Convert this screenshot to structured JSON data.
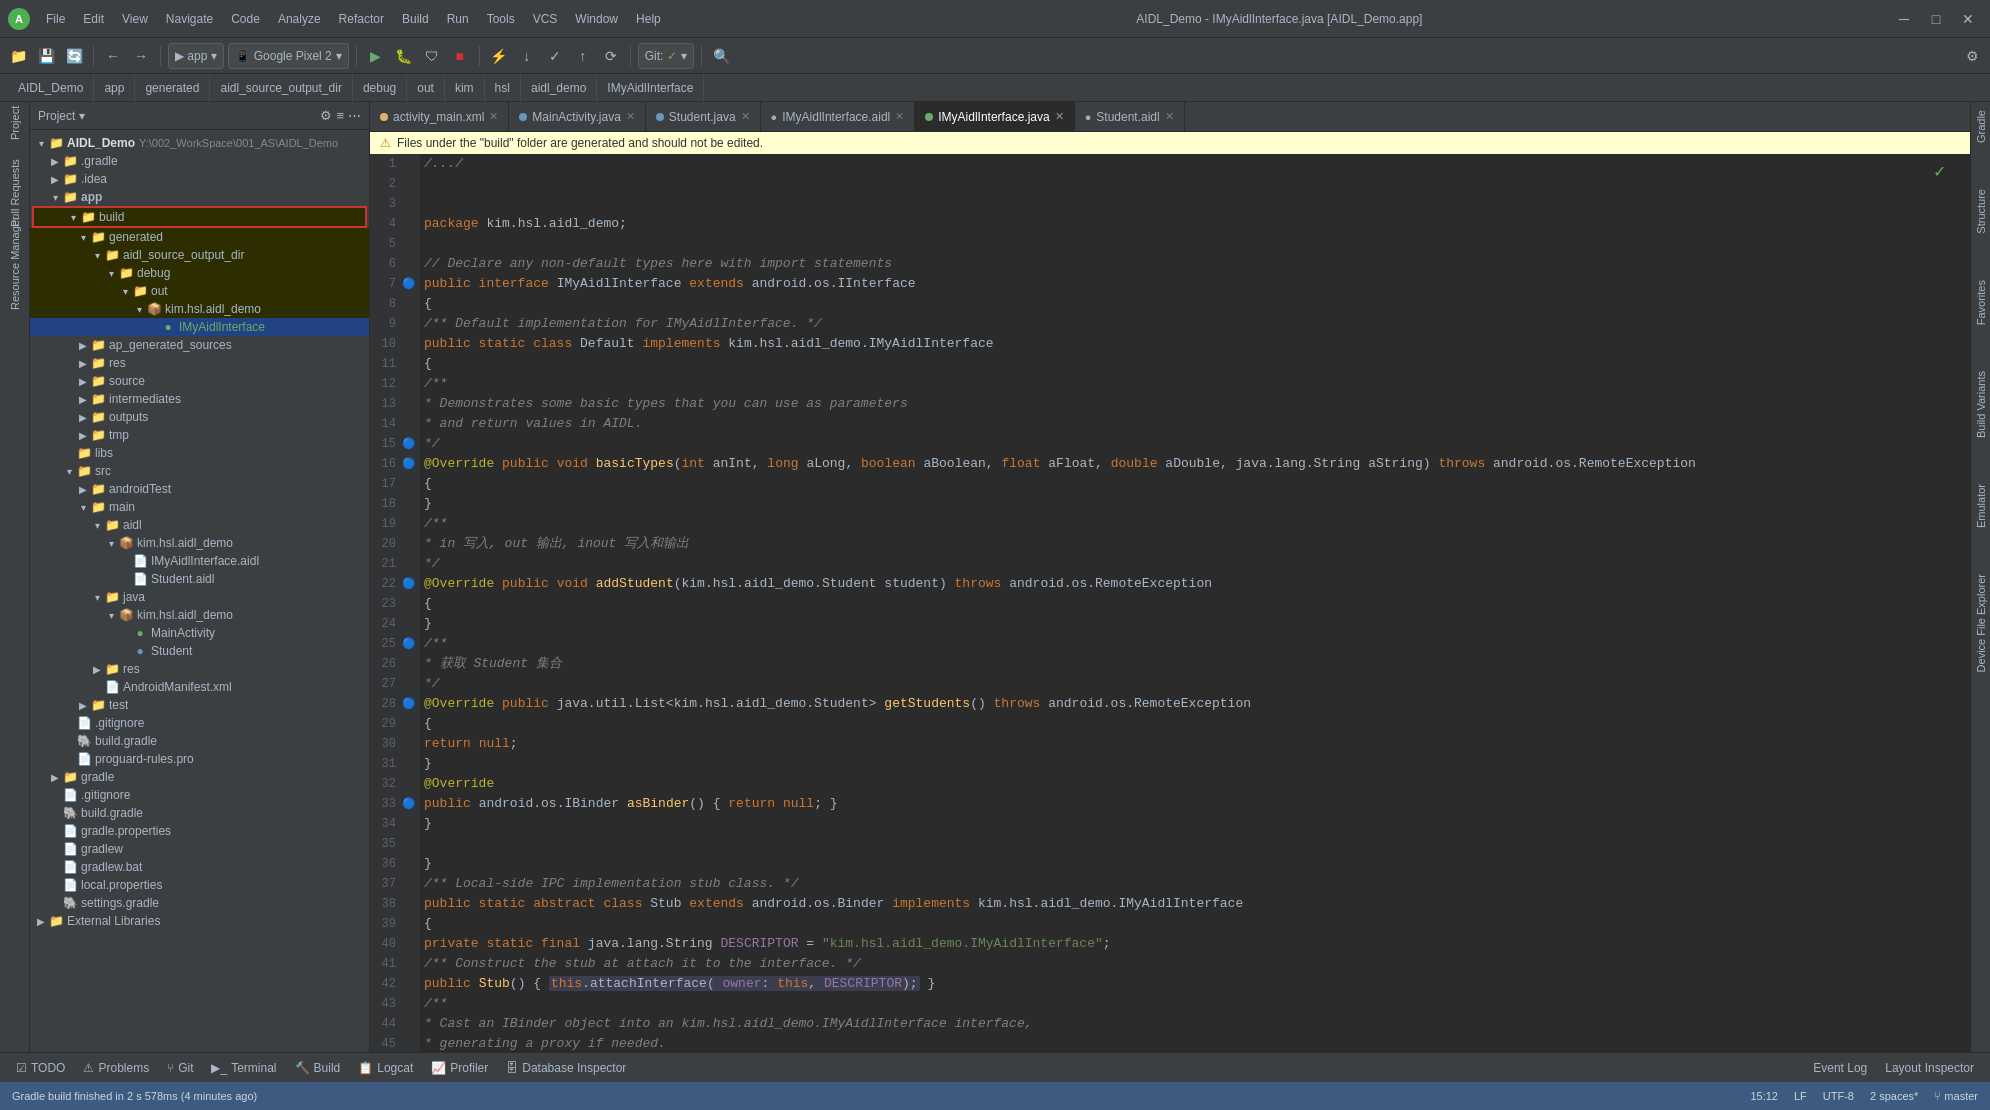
{
  "titlebar": {
    "project": "AIDL_Demo",
    "file": "IMyAidlInterface.java [AIDL_Demo.app]",
    "menus": [
      "File",
      "Edit",
      "View",
      "Navigate",
      "Code",
      "Analyze",
      "Refactor",
      "Build",
      "Run",
      "Tools",
      "VCS",
      "Window",
      "Help"
    ]
  },
  "breadcrumbs": [
    "AIDL_Demo",
    "app",
    "generated",
    "aidl_source_output_dir",
    "debug",
    "out",
    "kim",
    "hsl",
    "aidl_demo",
    "IMyAidlInterface"
  ],
  "editor_tabs": [
    {
      "label": "activity_main.xml",
      "type": "xml",
      "active": false
    },
    {
      "label": "MainActivity.java",
      "type": "java",
      "active": false
    },
    {
      "label": "Student.java",
      "type": "java",
      "active": false
    },
    {
      "label": "IMyAidlInterface.aidl",
      "type": "aidl",
      "active": false
    },
    {
      "label": "IMyAidlInterface.java",
      "type": "java",
      "active": true
    },
    {
      "label": "Student.aidl",
      "type": "aidl",
      "active": false
    }
  ],
  "warning_bar": "Files under the \"build\" folder are generated and should not be edited.",
  "project_tree": {
    "root": "AIDL_Demo",
    "root_path": "Y:\\002_WorkSpace\\001_AS\\AIDL_Demo"
  },
  "bottom_tabs": [
    "TODO",
    "Problems",
    "Git",
    "Terminal",
    "Build",
    "Logcat",
    "Profiler",
    "Database Inspector"
  ],
  "status_bar": {
    "message": "Gradle build finished in 2s 578ms (4 minutes ago)",
    "position": "15:12",
    "encoding": "UTF-8",
    "indent": "2 spaces*",
    "branch": "master",
    "right_panels": [
      "Event Log",
      "Layout Inspector"
    ]
  }
}
